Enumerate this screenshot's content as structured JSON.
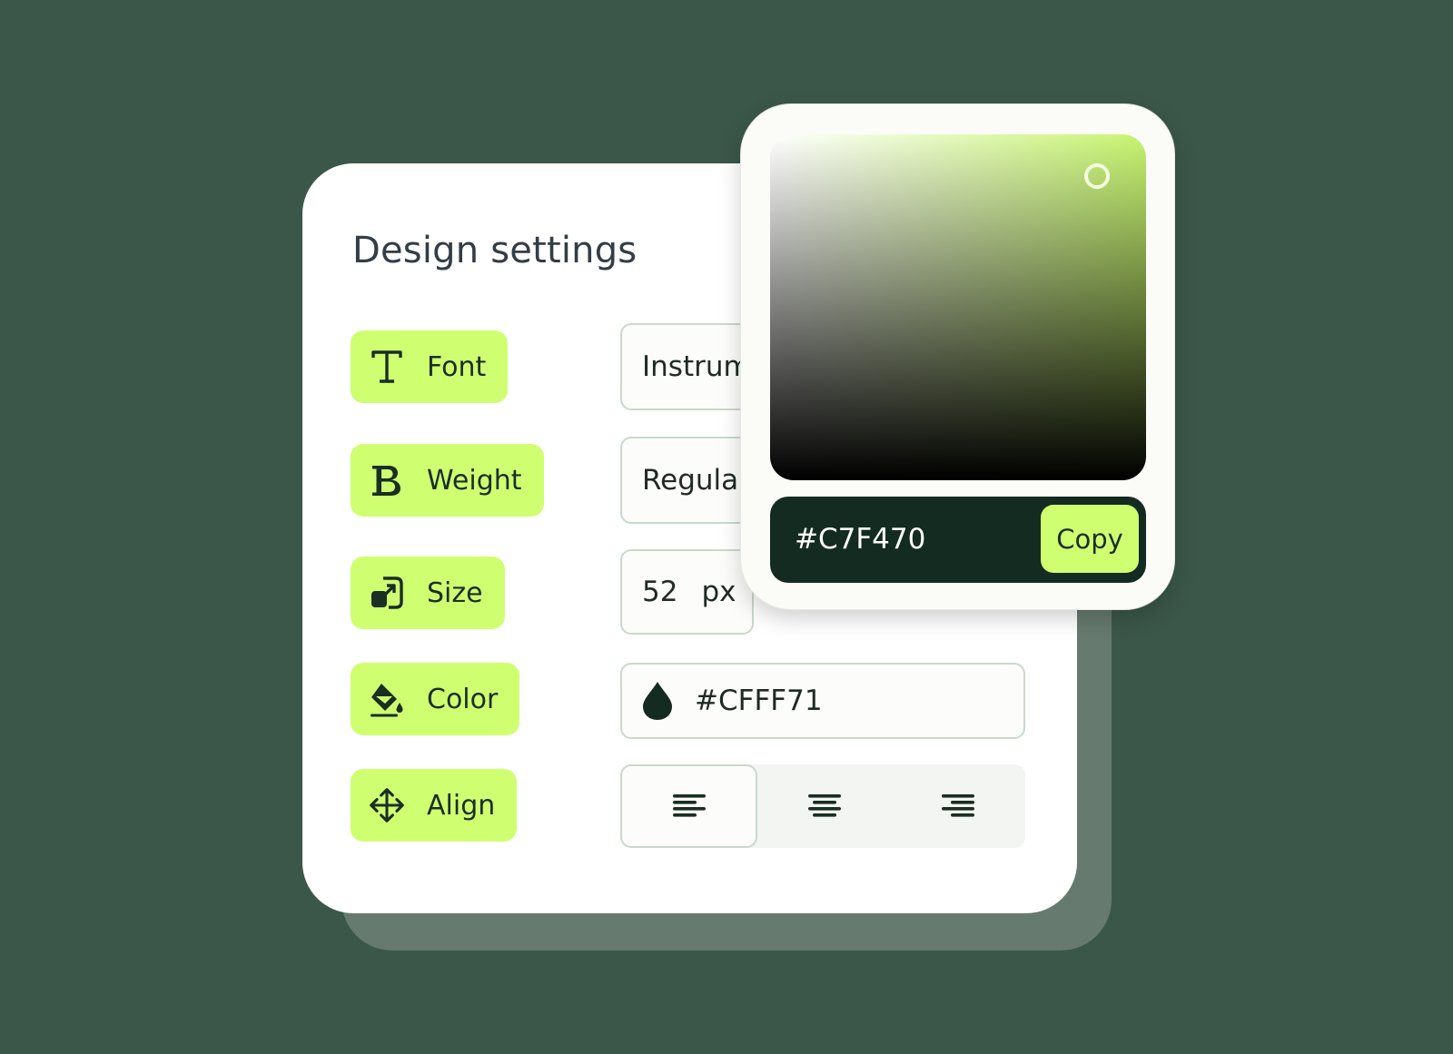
{
  "colors": {
    "background": "#3b574a",
    "card": "#ffffff",
    "chip": "#cfff71",
    "dark": "#142b22"
  },
  "panel": {
    "title": "Design settings"
  },
  "settings": [
    {
      "icon": "text-t-icon",
      "label": "Font",
      "value": "Instrument Sans"
    },
    {
      "icon": "bold-b-icon",
      "label": "Weight",
      "value": "Regular"
    },
    {
      "icon": "resize-icon",
      "label": "Size",
      "value": "52",
      "unit": "px"
    },
    {
      "icon": "paint-bucket-icon",
      "label": "Color",
      "value": "#CFFF71"
    },
    {
      "icon": "move-arrows-icon",
      "label": "Align",
      "selected": "left"
    }
  ],
  "color_picker": {
    "hex": "#C7F470",
    "copy_label": "Copy"
  }
}
